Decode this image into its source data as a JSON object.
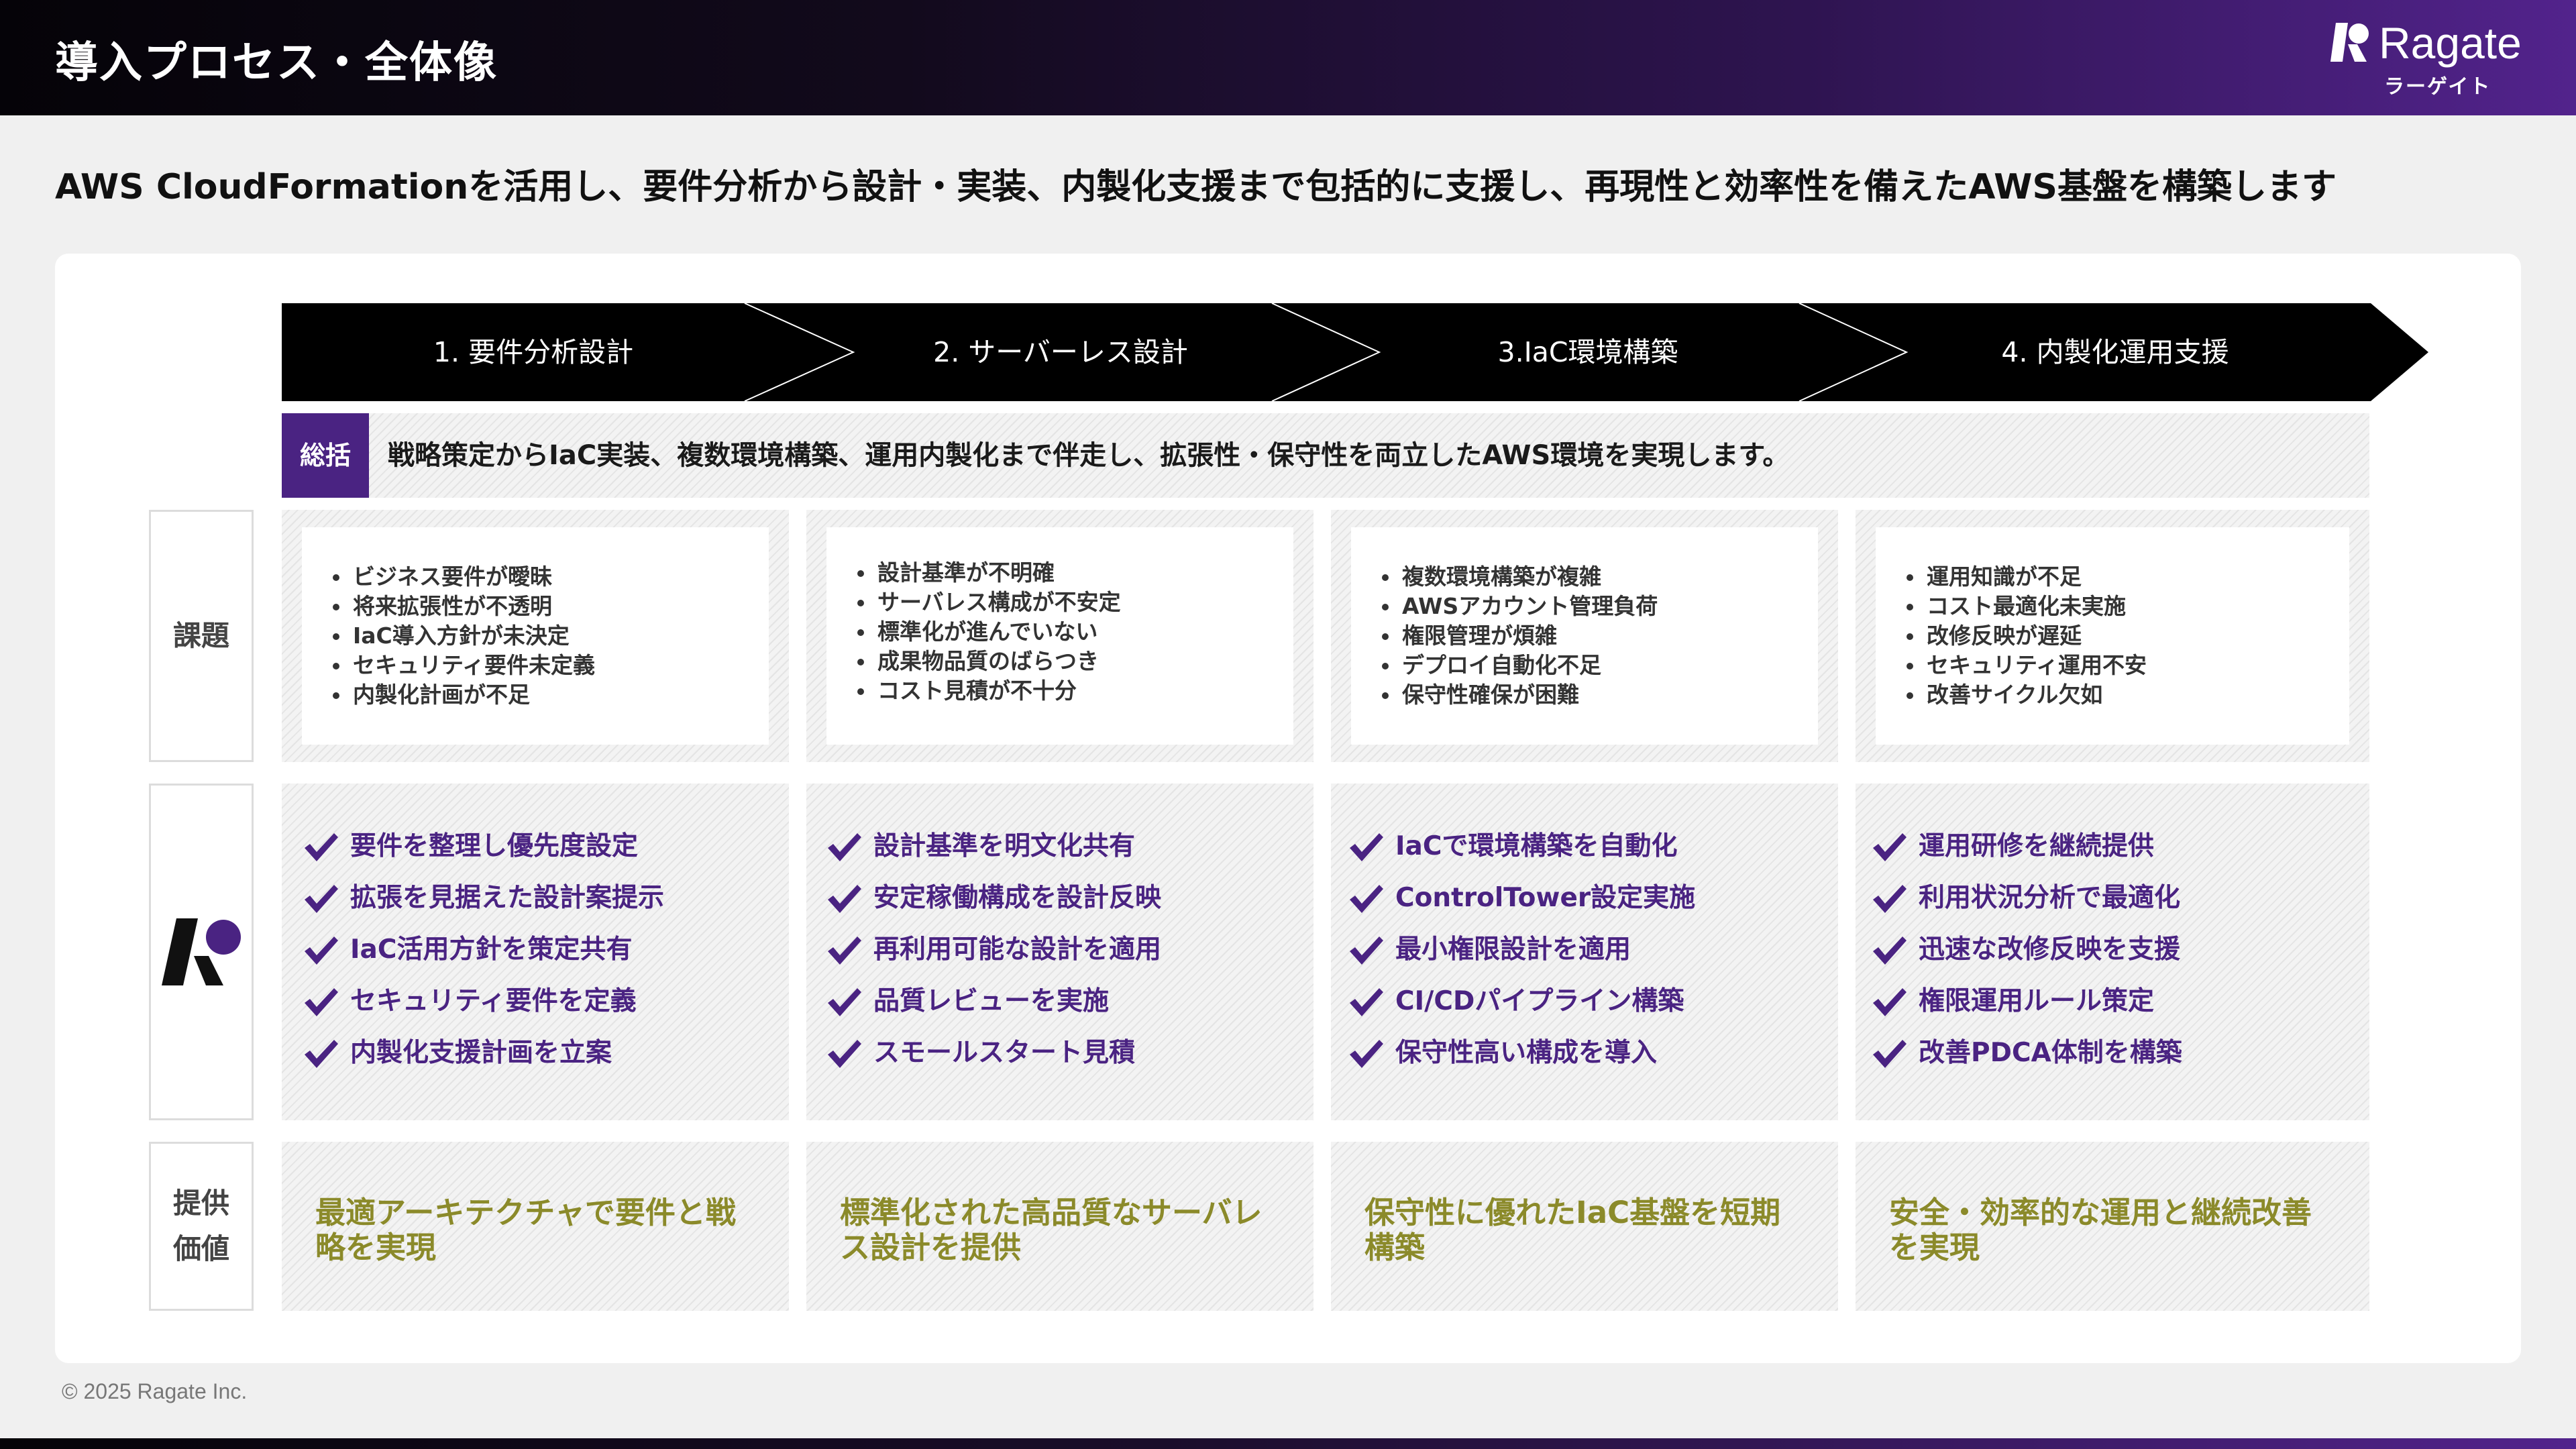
{
  "header": {
    "title": "導入プロセス・全体像",
    "logo_text": "Ragate",
    "logo_kana": "ラーゲイト"
  },
  "subtitle": "AWS CloudFormationを活用し、要件分析から設計・実装、内製化支援まで包括的に支援し、再現性と効率性を備えたAWS基盤を構築します",
  "steps": [
    {
      "label": "1. 要件分析設計"
    },
    {
      "label": "2. サーバーレス設計"
    },
    {
      "label": "3.IaC環境構築"
    },
    {
      "label": "4. 内製化運用支援"
    }
  ],
  "summary": {
    "badge": "総括",
    "text": "戦略策定からIaC実装、複数環境構築、運用内製化まで伴走し、拡張性・保守性を両立したAWS環境を実現します。"
  },
  "row_labels": {
    "issues": "課題",
    "value_line1": "提供",
    "value_line2": "価値"
  },
  "issues": [
    [
      "ビジネス要件が曖昧",
      "将来拡張性が不透明",
      "IaC導入方針が未決定",
      "セキュリティ要件未定義",
      "内製化計画が不足"
    ],
    [
      "設計基準が不明確",
      "サーバレス構成が不安定",
      "標準化が進んでいない",
      "成果物品質のばらつき",
      "コスト見積が不十分"
    ],
    [
      "複数環境構築が複雑",
      "AWSアカウント管理負荷",
      "権限管理が煩雑",
      "デプロイ自動化不足",
      "保守性確保が困難"
    ],
    [
      "運用知識が不足",
      "コスト最適化未実施",
      "改修反映が遅延",
      "セキュリティ運用不安",
      "改善サイクル欠如"
    ]
  ],
  "solutions": [
    [
      "要件を整理し優先度設定",
      "拡張を見据えた設計案提示",
      "IaC活用方針を策定共有",
      "セキュリティ要件を定義",
      "内製化支援計画を立案"
    ],
    [
      "設計基準を明文化共有",
      "安定稼働構成を設計反映",
      "再利用可能な設計を適用",
      "品質レビューを実施",
      "スモールスタート見積"
    ],
    [
      "IaCで環境構築を自動化",
      "ControlTower設定実施",
      "最小権限設計を適用",
      "CI/CDパイプライン構築",
      "保守性高い構成を導入"
    ],
    [
      "運用研修を継続提供",
      "利用状況分析で最適化",
      "迅速な改修反映を支援",
      "権限運用ルール策定",
      "改善PDCA体制を構築"
    ]
  ],
  "values": [
    "最適アーキテクチャで要件と戦略を実現",
    "標準化された高品質なサーバレス設計を提供",
    "保守性に優れたIaC基盤を短期構築",
    "安全・効率的な運用と継続改善を実現"
  ],
  "footer": {
    "copyright": "© 2025 Ragate Inc."
  },
  "colors": {
    "purple": "#4a2382",
    "olive": "#8b8a2a",
    "header_dark": "#050308",
    "header_purple": "#52238c"
  },
  "icons": {
    "logo": "ragate-logo-icon",
    "check": "check-icon"
  }
}
